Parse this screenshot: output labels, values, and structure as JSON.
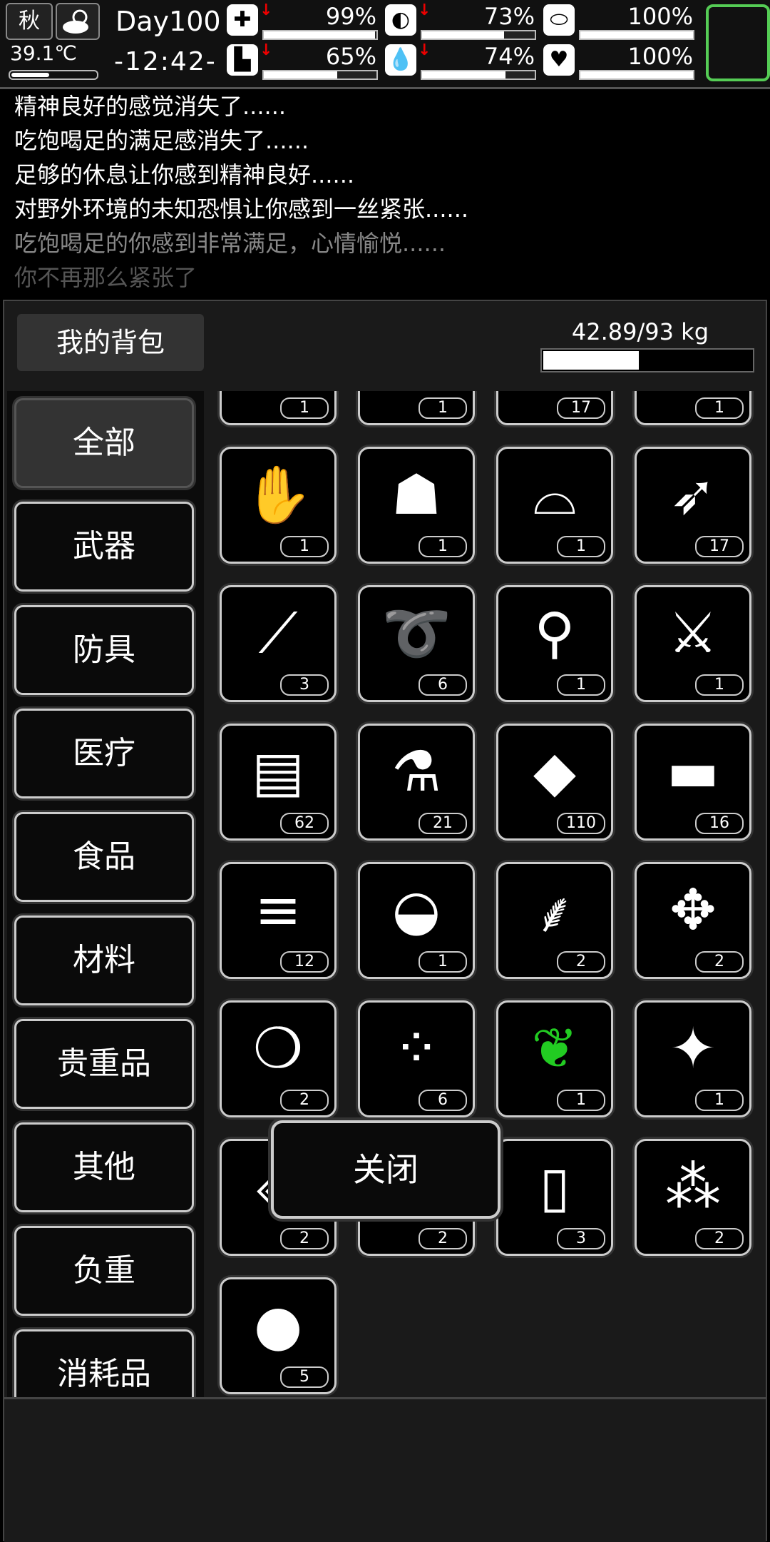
{
  "status": {
    "season": "秋",
    "temperature": "39.1℃",
    "temperature_level": 0.45,
    "day": "Day100",
    "time": "-12:42-",
    "stats": [
      {
        "name": "health",
        "icon": "medkit-icon",
        "value": "99%",
        "level": 0.99,
        "decreasing": true
      },
      {
        "name": "hunger",
        "icon": "stomach-icon",
        "value": "73%",
        "level": 0.73,
        "decreasing": true
      },
      {
        "name": "mood",
        "icon": "pill-icon",
        "value": "100%",
        "level": 1.0,
        "decreasing": false
      },
      {
        "name": "stamina",
        "icon": "boot-icon",
        "value": "65%",
        "level": 0.65,
        "decreasing": true
      },
      {
        "name": "thirst",
        "icon": "water-drop-icon",
        "value": "74%",
        "level": 0.74,
        "decreasing": true
      },
      {
        "name": "heart",
        "icon": "heart-icon",
        "value": "100%",
        "level": 1.0,
        "decreasing": false
      }
    ]
  },
  "log": [
    "精神良好的感觉消失了......",
    "吃饱喝足的满足感消失了......",
    "足够的休息让你感到精神良好......",
    "对野外环境的未知恐惧让你感到一丝紧张......",
    "吃饱喝足的你感到非常满足，心情愉悦......",
    "你不再那么紧张了"
  ],
  "inventory": {
    "title": "我的背包",
    "weight": "42.89/93 kg",
    "weight_level": 0.46,
    "categories": [
      "全部",
      "武器",
      "防具",
      "医疗",
      "食品",
      "材料",
      "贵重品",
      "其他",
      "负重",
      "消耗品"
    ],
    "items": [
      {
        "icon": "box-icon",
        "count": "1"
      },
      {
        "icon": "tool-icon",
        "count": "1"
      },
      {
        "icon": "spikes-icon",
        "count": "17"
      },
      {
        "icon": "wheel-icon",
        "count": "1"
      },
      {
        "icon": "bandaged-glove-icon",
        "count": "1"
      },
      {
        "icon": "hooded-cloak-icon",
        "count": "1"
      },
      {
        "icon": "hat-icon",
        "count": "1"
      },
      {
        "icon": "arrow-icon",
        "count": "17"
      },
      {
        "icon": "lockpick-icon",
        "count": "3"
      },
      {
        "icon": "rope-icon",
        "count": "6"
      },
      {
        "icon": "shovel-icon",
        "count": "1"
      },
      {
        "icon": "axe-icon",
        "count": "1"
      },
      {
        "icon": "cloth-icon",
        "count": "62"
      },
      {
        "icon": "test-tube-icon",
        "count": "21"
      },
      {
        "icon": "stone-icon",
        "count": "110"
      },
      {
        "icon": "log-icon",
        "count": "16"
      },
      {
        "icon": "firewood-icon",
        "count": "12"
      },
      {
        "icon": "meat-icon",
        "count": "1"
      },
      {
        "icon": "wheat-icon",
        "count": "2"
      },
      {
        "icon": "ginger-icon",
        "count": "2"
      },
      {
        "icon": "seeds-icon",
        "count": "2"
      },
      {
        "icon": "berries-icon",
        "count": "6"
      },
      {
        "icon": "herb-leaf-icon",
        "count": "1",
        "color": "#22cc22"
      },
      {
        "icon": "root-icon",
        "count": "1"
      },
      {
        "icon": "rock-shard-icon",
        "count": "2"
      },
      {
        "icon": "fabric-icon",
        "count": "2"
      },
      {
        "icon": "paper-icon",
        "count": "3"
      },
      {
        "icon": "beans-icon",
        "count": "2"
      },
      {
        "icon": "potato-icon",
        "count": "5"
      }
    ]
  },
  "close_label": "关闭",
  "colors": {
    "accent": "#5cc65c",
    "alert": "#ee0000",
    "herb": "#22cc22"
  }
}
